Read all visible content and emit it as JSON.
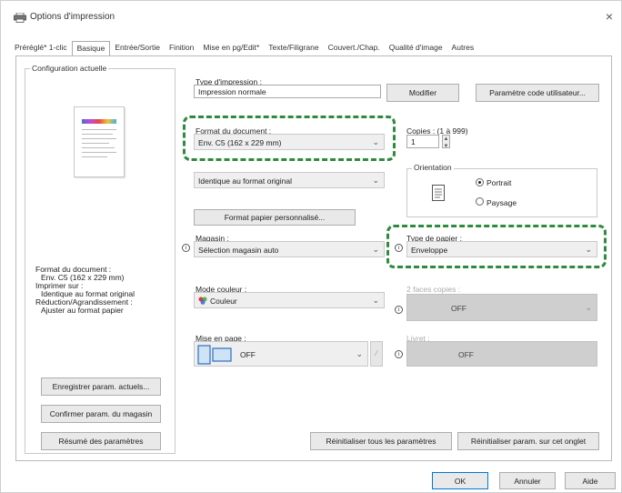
{
  "window": {
    "title": "Options d'impression",
    "close_glyph": "×"
  },
  "tabs": [
    {
      "label": "Préréglé* 1-clic"
    },
    {
      "label": "Basique"
    },
    {
      "label": "Entrée/Sortie"
    },
    {
      "label": "Finition"
    },
    {
      "label": "Mise en pg/Edit*"
    },
    {
      "label": "Texte/Filigrane"
    },
    {
      "label": "Couvert./Chap."
    },
    {
      "label": "Qualité d'image"
    },
    {
      "label": "Autres"
    }
  ],
  "left_panel": {
    "group_label": "Configuration actuelle",
    "summary": [
      "Format du document :",
      "Env. C5 (162 x 229 mm)",
      "Imprimer sur :",
      "Identique au format original",
      "Réduction/Agrandissement :",
      "Ajuster au format papier"
    ],
    "buttons": {
      "save": "Enregistrer param. actuels...",
      "confirm": "Confirmer param. du magasin",
      "summary": "Résumé des paramètres"
    }
  },
  "print_type": {
    "label": "Type d'impression :",
    "value": "Impression normale",
    "modify_button": "Modifier",
    "user_code_button": "Paramètre code utilisateur..."
  },
  "document_size": {
    "label": "Format du document :",
    "value": "Env. C5 (162 x 229 mm)"
  },
  "print_on": {
    "value": "Identique au format original"
  },
  "custom_paper_button": "Format papier personnalisé...",
  "copies": {
    "label": "Copies : (1 à 999)",
    "value": "1"
  },
  "orientation": {
    "label": "Orientation",
    "portrait": "Portrait",
    "landscape": "Paysage",
    "selected": "Portrait"
  },
  "tray": {
    "label": "Magasin :",
    "value": "Sélection magasin auto"
  },
  "paper_type": {
    "label": "Type de papier :",
    "value": "Enveloppe"
  },
  "color_mode": {
    "label": "Mode couleur :",
    "value": "Couleur"
  },
  "two_sided": {
    "label": "2 faces copies :",
    "value": "OFF"
  },
  "layout": {
    "label": "Mise en page :",
    "value": "OFF"
  },
  "booklet": {
    "label": "Livret :",
    "value": "OFF"
  },
  "bottom_buttons": {
    "reset_all": "Réinitialiser tous les paramètres",
    "reset_tab": "Réinitialiser param. sur cet onglet"
  },
  "dialog_buttons": {
    "ok": "OK",
    "cancel": "Annuler",
    "help": "Aide"
  },
  "colors": {
    "highlight": "#2e8b3c"
  }
}
